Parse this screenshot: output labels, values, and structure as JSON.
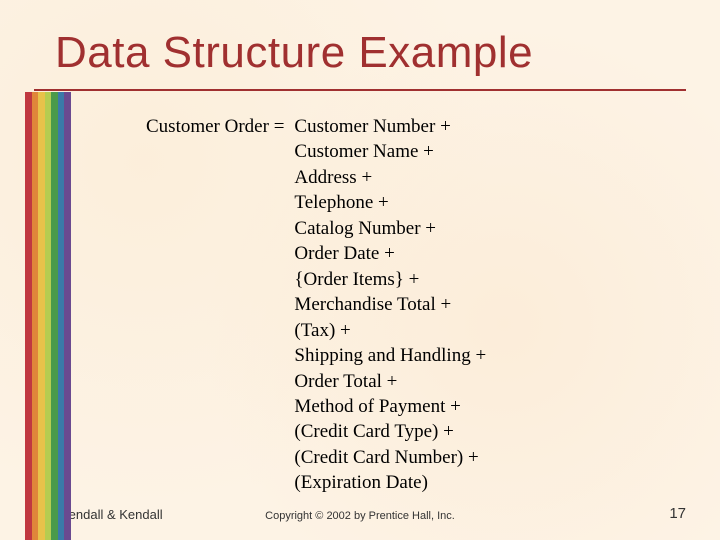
{
  "title": "Data Structure Example",
  "definition": {
    "lhs": "Customer Order =",
    "rhs": [
      "Customer Number +",
      "Customer Name +",
      "Address +",
      "Telephone +",
      "Catalog Number +",
      "Order Date +",
      "{Order Items} +",
      "Merchandise Total +",
      "(Tax) +",
      "Shipping and Handling +",
      "Order Total +",
      "Method of Payment +",
      "(Credit Card Type) +",
      "(Credit Card Number) +",
      "(Expiration Date)"
    ]
  },
  "footer": {
    "authors": "Kendall & Kendall",
    "copyright": "Copyright © 2002 by Prentice Hall, Inc.",
    "page": "17"
  },
  "colors": {
    "title": "#a03030",
    "background": "#fdf3e5"
  }
}
